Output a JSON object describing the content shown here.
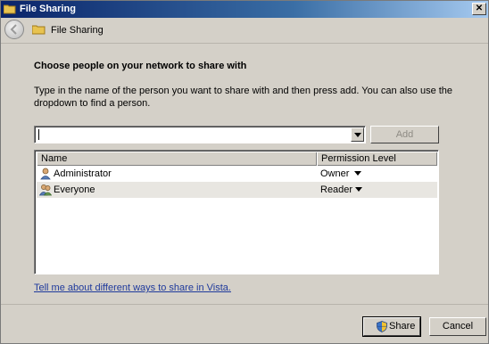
{
  "window": {
    "title": "File Sharing"
  },
  "nav": {
    "title": "File Sharing"
  },
  "main": {
    "heading": "Choose people on your network to share with",
    "instructions": "Type in the name of the person you want to share with and then press add.  You can also use the dropdown to find a person.",
    "combo_value": "",
    "add_label": "Add"
  },
  "list": {
    "columns": [
      "Name",
      "Permission Level"
    ],
    "rows": [
      {
        "name": "Administrator",
        "permission": "Owner"
      },
      {
        "name": "Everyone",
        "permission": "Reader"
      }
    ]
  },
  "help_link": "Tell me about different ways to share in Vista.",
  "footer": {
    "share_label": "Share",
    "cancel_label": "Cancel"
  }
}
